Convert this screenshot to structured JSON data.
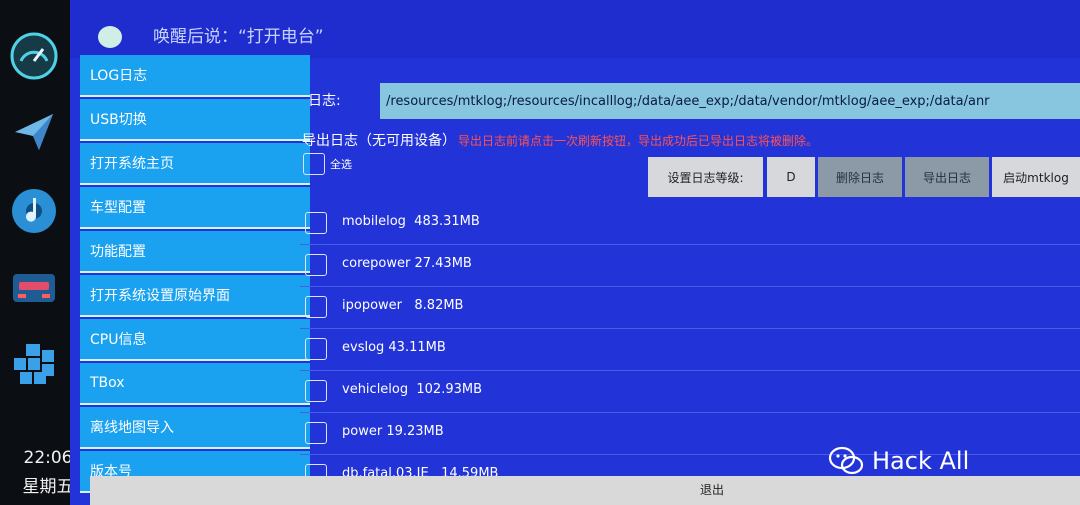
{
  "status": {
    "time": "22:06",
    "weekday": "星期五"
  },
  "dock": [
    "speedometer-icon",
    "navigation-icon",
    "music-icon",
    "car-icon",
    "apps-icon"
  ],
  "voice_hint": "唤醒后说：“打开电台”",
  "sidebar": {
    "items": [
      {
        "label": "LOG日志"
      },
      {
        "label": "USB切换"
      },
      {
        "label": "打开系统主页"
      },
      {
        "label": "车型配置"
      },
      {
        "label": "功能配置"
      },
      {
        "label": "打开系统设置原始界面"
      },
      {
        "label": "CPU信息"
      },
      {
        "label": "TBox"
      },
      {
        "label": "离线地图导入"
      },
      {
        "label": "版本号"
      }
    ]
  },
  "main": {
    "log_label": "日志:",
    "log_paths": "/resources/mtklog;/resources/incalllog;/data/aee_exp;/data/vendor/mtklog/aee_exp;/data/anr",
    "export_title": "导出日志（无可用设备）",
    "export_warning": "导出日志前请点击一次刷新按钮，导出成功后已导出日志将被删除。",
    "select_all": "全选",
    "buttons": {
      "set_level": "设置日志等级:",
      "level_value": "D",
      "delete": "删除日志",
      "export": "导出日志",
      "start_mtklog": "启动mtklog"
    },
    "logs": [
      {
        "label": "mobilelog  483.31MB"
      },
      {
        "label": "corepower 27.43MB"
      },
      {
        "label": "ipopower   8.82MB"
      },
      {
        "label": "evslog 43.11MB"
      },
      {
        "label": "vehiclelog  102.93MB"
      },
      {
        "label": "power 19.23MB"
      },
      {
        "label": "db.fatal.03.JE   14.59MB"
      }
    ]
  },
  "exit": "退出",
  "watermark": {
    "brand": "Hack All",
    "url": "blog.hackall.cn"
  },
  "colors": {
    "screen_bg": "#2233d8",
    "sidebar_item": "#1aa1f0",
    "warning": "#ff5252"
  }
}
